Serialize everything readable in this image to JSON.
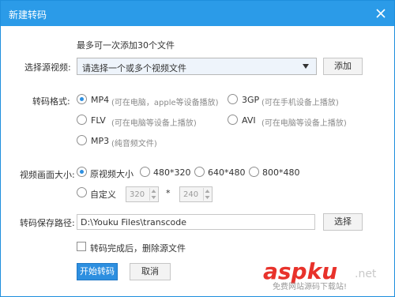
{
  "window": {
    "title": "新建转码"
  },
  "info": {
    "max_files": "最多可一次添加30个文件"
  },
  "source": {
    "label": "选择源视频:",
    "select_value": "请选择一个或多个视频文件",
    "add_button": "添加"
  },
  "format": {
    "label": "转码格式:",
    "options": [
      {
        "name": "MP4",
        "note": "(可在电脑，apple等设备播放)",
        "checked": true
      },
      {
        "name": "3GP",
        "note": "(可在手机设备上播放)",
        "checked": false
      },
      {
        "name": "FLV",
        "note": "(可在电脑等设备上播放)",
        "checked": false
      },
      {
        "name": "AVI",
        "note": "(可在电脑等设备上播放)",
        "checked": false
      },
      {
        "name": "MP3",
        "note": "(纯音频文件)",
        "checked": false
      }
    ]
  },
  "size": {
    "label": "视频画面大小:",
    "options": [
      "原视频大小",
      "480*320",
      "640*480",
      "800*480"
    ],
    "selected_index": 0,
    "custom_label": "自定义",
    "custom_width": "320",
    "custom_height": "240",
    "separator": "*"
  },
  "save": {
    "label": "转码保存路径:",
    "path": "D:\\Youku Files\\transcode",
    "choose_button": "选择"
  },
  "delete_source": {
    "label": "转码完成后，删除源文件",
    "checked": false
  },
  "actions": {
    "start": "开始转码",
    "cancel": "取消"
  },
  "watermark": {
    "brand": "aspku",
    "suffix": ".net",
    "tagline": "免费网站源码下载站!"
  },
  "colors": {
    "title_bar": "#2b9be8",
    "primary": "#2d8fe0",
    "watermark_red": "#e8322b"
  },
  "icons": {
    "close": "close-icon",
    "dropdown": "chevron-down-icon"
  }
}
